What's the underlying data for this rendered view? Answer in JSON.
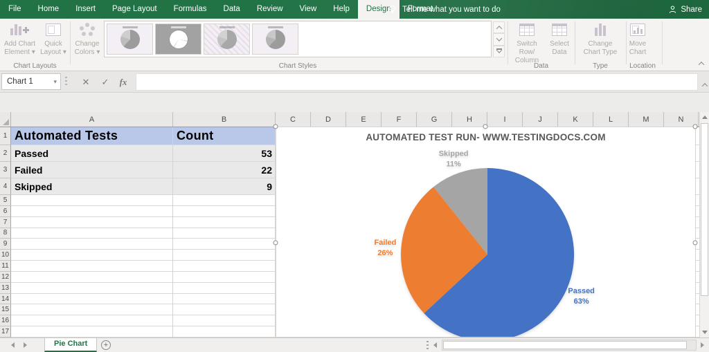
{
  "app": {
    "accent_green": "#217346"
  },
  "menu": {
    "tabs": [
      {
        "label": "File"
      },
      {
        "label": "Home"
      },
      {
        "label": "Insert"
      },
      {
        "label": "Page Layout"
      },
      {
        "label": "Formulas"
      },
      {
        "label": "Data"
      },
      {
        "label": "Review"
      },
      {
        "label": "View"
      },
      {
        "label": "Help"
      },
      {
        "label": "Design",
        "active": true
      },
      {
        "label": "Format"
      }
    ],
    "tell_me": "Tell me what you want to do",
    "share": "Share"
  },
  "ribbon": {
    "add_chart_element": "Add Chart\nElement ▾",
    "quick_layout": "Quick\nLayout ▾",
    "chart_layouts_label": "Chart Layouts",
    "change_colors": "Change\nColors ▾",
    "chart_styles_label": "Chart Styles",
    "switch_row_column": "Switch Row/\nColumn",
    "select_data": "Select\nData",
    "data_label": "Data",
    "change_chart_type": "Change\nChart Type",
    "type_label": "Type",
    "move_chart": "Move\nChart",
    "location_label": "Location"
  },
  "formula_bar": {
    "name_box": "Chart 1",
    "cancel": "✕",
    "enter": "✓",
    "fx": "fx",
    "formula_value": ""
  },
  "sheet": {
    "columns": [
      "A",
      "B",
      "C",
      "D",
      "E",
      "F",
      "G",
      "H",
      "I",
      "J",
      "K",
      "L",
      "M",
      "N"
    ],
    "rows": [
      "1",
      "2",
      "3",
      "4",
      "5",
      "6",
      "7",
      "8",
      "9",
      "10",
      "11",
      "12",
      "13",
      "14",
      "15",
      "16",
      "17"
    ],
    "table": {
      "header": {
        "col_a": "Automated Tests",
        "col_b": "Count",
        "bg": "#b9c7e8"
      },
      "rows": [
        {
          "label": "Passed",
          "value": "53"
        },
        {
          "label": "Failed",
          "value": "22"
        },
        {
          "label": "Skipped",
          "value": "9"
        }
      ],
      "row_bg": "#e9e9e9"
    },
    "tab_name": "Pie Chart"
  },
  "chart_data": {
    "type": "pie",
    "title": "AUTOMATED TEST RUN- WWW.TESTINGDOCS.COM",
    "title_color": "#595959",
    "categories": [
      "Passed",
      "Failed",
      "Skipped"
    ],
    "values": [
      53,
      22,
      9
    ],
    "percent_labels": [
      "63%",
      "26%",
      "11%"
    ],
    "colors": [
      "#4472c4",
      "#ed7d31",
      "#a5a5a5"
    ],
    "start_angle_deg": 0,
    "direction": "clockwise",
    "legend": "none",
    "labels_position": "outside-end"
  }
}
